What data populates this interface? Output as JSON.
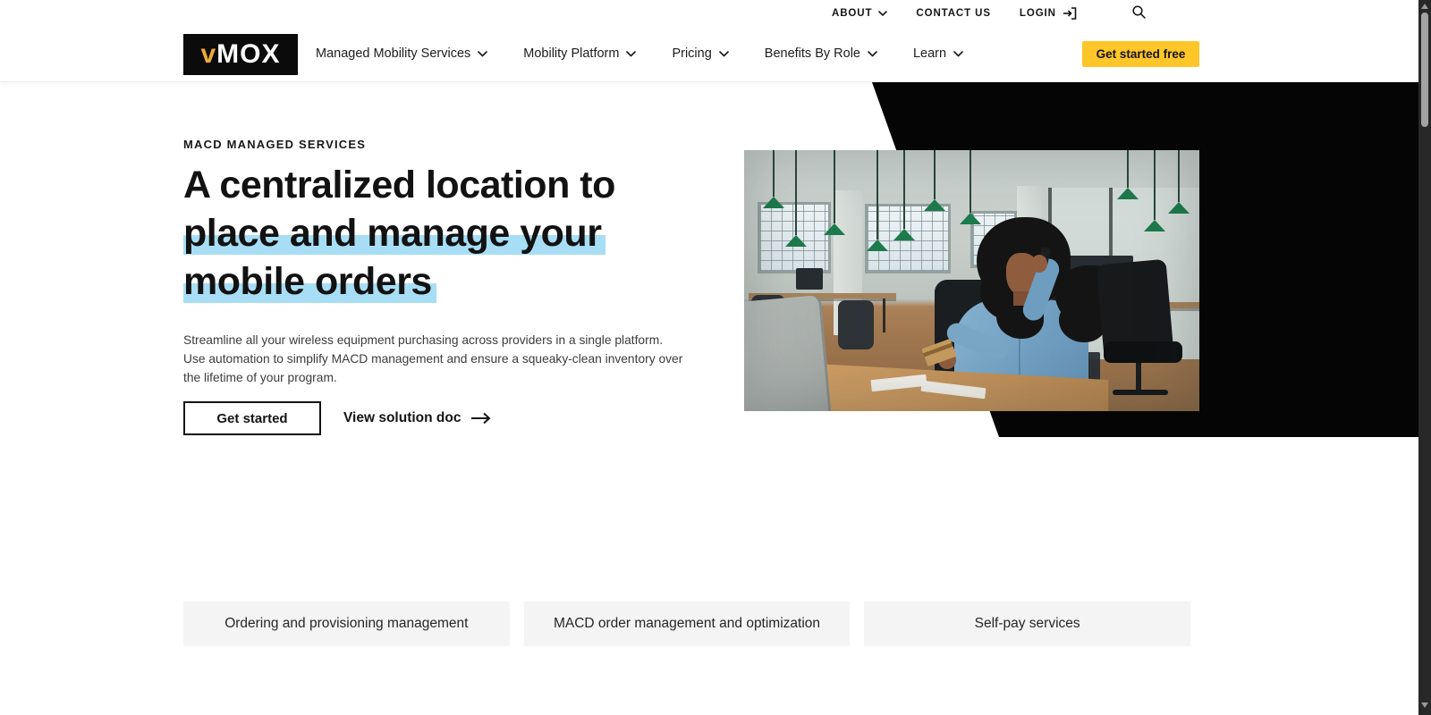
{
  "topbar": {
    "about": "ABOUT",
    "contact": "CONTACT US",
    "login": "LOGIN"
  },
  "nav": {
    "logo_v": "v",
    "logo_rest": "MOX",
    "items": [
      "Managed Mobility Services",
      "Mobility Platform",
      "Pricing",
      "Benefits By Role",
      "Learn"
    ],
    "cta": "Get started free"
  },
  "hero": {
    "eyebrow": "MACD MANAGED SERVICES",
    "headline_line1": "A centralized location to",
    "headline_line2": "place and manage your",
    "headline_line3": "mobile orders",
    "paragraph": "Streamline all your wireless equipment purchasing across providers in a single platform. Use automation to simplify MACD management and ensure a squeaky-clean inventory over the lifetime of your program.",
    "cta_primary": "Get started",
    "cta_secondary": "View solution doc"
  },
  "tabs": {
    "items": [
      "Ordering and provisioning management",
      "MACD order management and optimization",
      "Self-pay services"
    ]
  },
  "colors": {
    "accent_yellow": "#FFC629",
    "highlight_blue": "#A8DEF5",
    "logo_gold": "#EDA93C",
    "hero_black": "#050505"
  }
}
